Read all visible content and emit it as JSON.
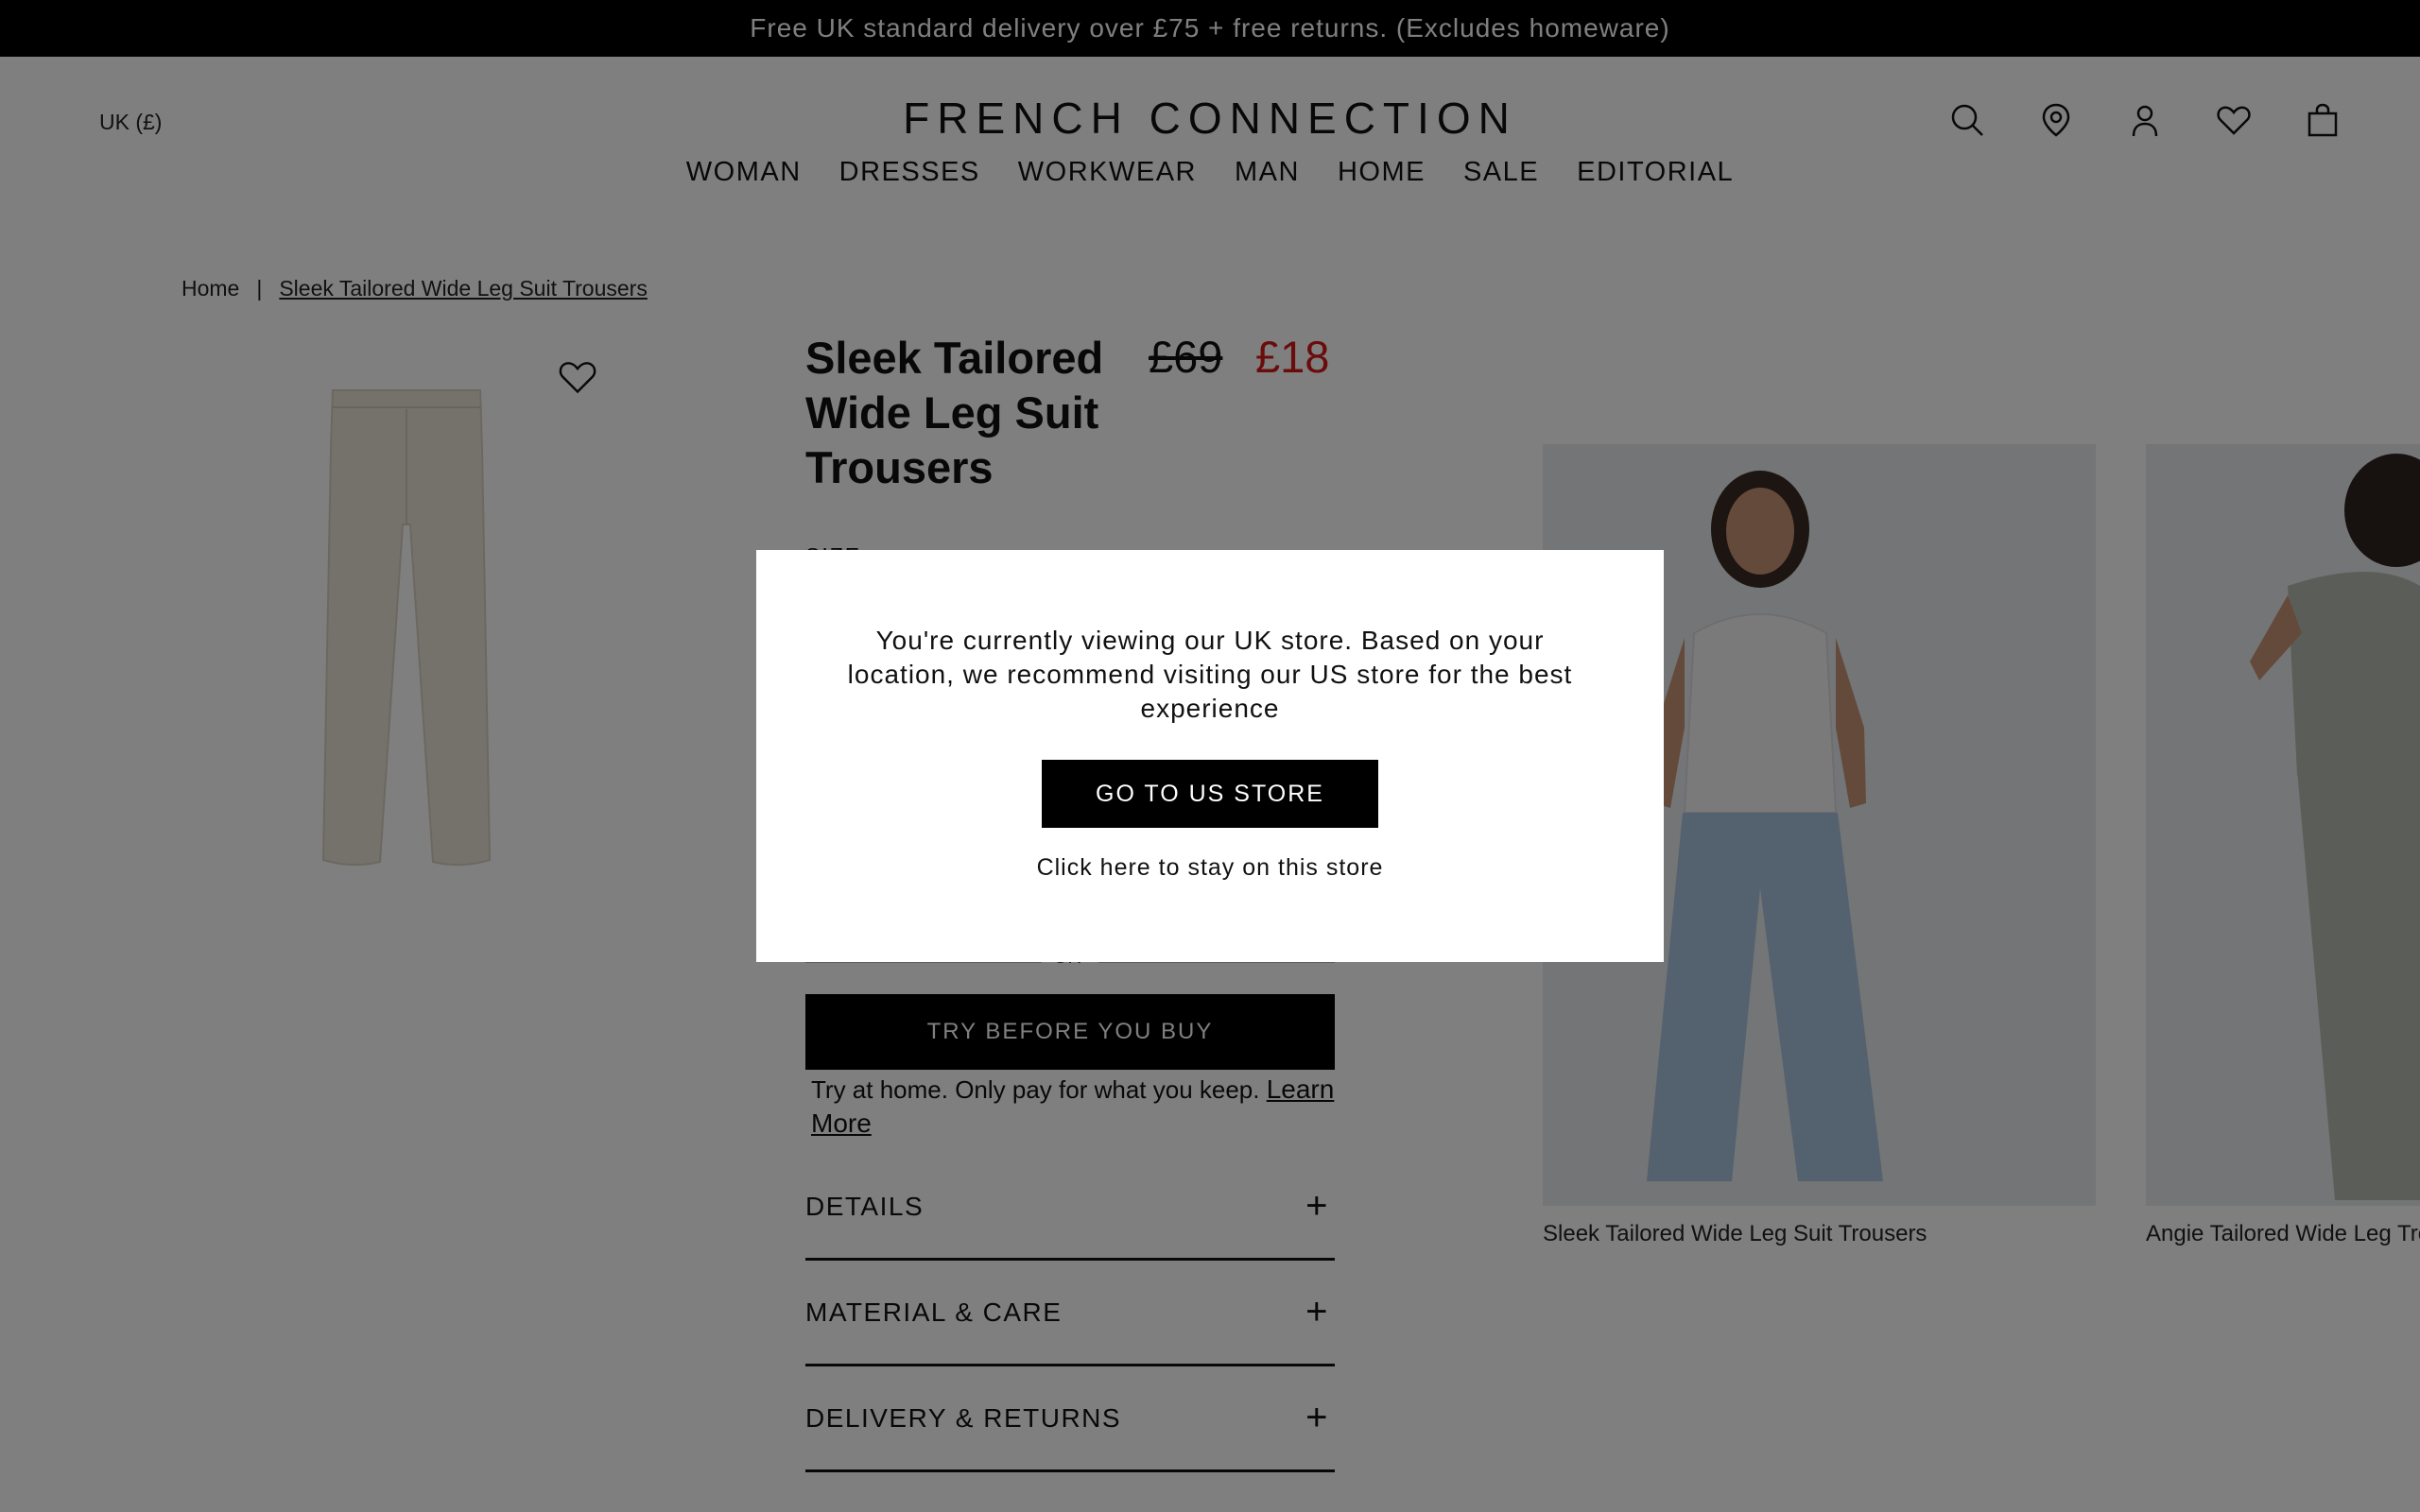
{
  "promo": {
    "text": "Free UK standard delivery over £75 + free returns. (Excludes homeware)"
  },
  "header": {
    "locale": "UK (£)",
    "logo": "FRENCH CONNECTION",
    "icons": [
      "search-icon",
      "location-pin-icon",
      "account-icon",
      "heart-icon",
      "bag-icon"
    ],
    "nav": [
      "WOMAN",
      "DRESSES",
      "WORKWEAR",
      "MAN",
      "HOME",
      "SALE",
      "EDITORIAL"
    ]
  },
  "breadcrumb": {
    "home": "Home",
    "separator": "|",
    "current": "Sleek Tailored Wide Leg Suit Trousers"
  },
  "product": {
    "title": "Sleek Tailored Wide Leg Suit Trousers",
    "price_old": "£69",
    "price_new": "£18",
    "size_label": "SIZE",
    "or_text": "OR",
    "try_button": "TRY BEFORE YOU BUY",
    "try_note": "Try at home. Only pay for what you keep.",
    "learn_more": "Learn More",
    "accordion": [
      "DETAILS",
      "MATERIAL & CARE",
      "DELIVERY & RETURNS"
    ],
    "accordion_icon": "+"
  },
  "recommendations": [
    {
      "name": "Sleek Tailored Wide Leg Suit Trousers"
    },
    {
      "name": "Angie Tailored Wide Leg Trousers"
    }
  ],
  "modal": {
    "message": "You're currently viewing our UK store. Based on your location, we recommend visiting our US store for the best experience",
    "button": "GO TO US STORE",
    "stay_link": "Click here to stay on this store"
  },
  "colors": {
    "sale_red": "#d41919",
    "black": "#000000",
    "overlay": "rgba(0,0,0,0.5)"
  }
}
